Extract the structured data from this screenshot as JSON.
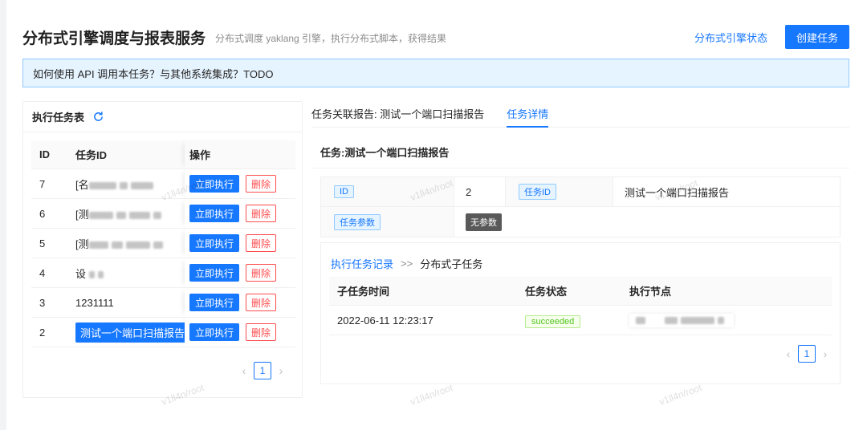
{
  "header": {
    "title": "分布式引擎调度与报表服务",
    "subtitle": "分布式调度 yaklang 引擎，执行分布式脚本，获得结果",
    "status_link": "分布式引擎状态",
    "create_button": "创建任务"
  },
  "banner": {
    "text": "如何使用 API 调用本任务？与其他系统集成？TODO"
  },
  "task_table": {
    "title": "执行任务表",
    "columns": [
      "ID",
      "任务ID",
      "操作"
    ],
    "run_label": "立即执行",
    "delete_label": "删除",
    "rows": [
      {
        "id": "7",
        "task_id": "[名"
      },
      {
        "id": "6",
        "task_id": "[测"
      },
      {
        "id": "5",
        "task_id": "[测"
      },
      {
        "id": "4",
        "task_id": "设"
      },
      {
        "id": "3",
        "task_id": "1231111"
      },
      {
        "id": "2",
        "task_id": "测试一个端口扫描报告"
      }
    ],
    "page": "1"
  },
  "tabs": [
    "任务关联报告: 测试一个端口扫描报告",
    "任务详情"
  ],
  "detail": {
    "heading": "任务:测试一个端口扫描报告",
    "id_label": "ID",
    "id_value": "2",
    "task_id_label": "任务ID",
    "task_id_value": "测试一个端口扫描报告",
    "params_label": "任务参数",
    "params_value": "无参数"
  },
  "subtasks": {
    "crumb_link": "执行任务记录",
    "crumb_sep": ">>",
    "crumb_current": "分布式子任务",
    "columns": [
      "子任务时间",
      "任务状态",
      "执行节点"
    ],
    "rows": [
      {
        "time": "2022-06-11 12:23:17",
        "status": "succeeded"
      }
    ],
    "page": "1"
  },
  "watermark": "v1ll4n/root",
  "colors": {
    "primary": "#1677ff",
    "danger": "#ff4d4f",
    "success": "#52c41a"
  }
}
